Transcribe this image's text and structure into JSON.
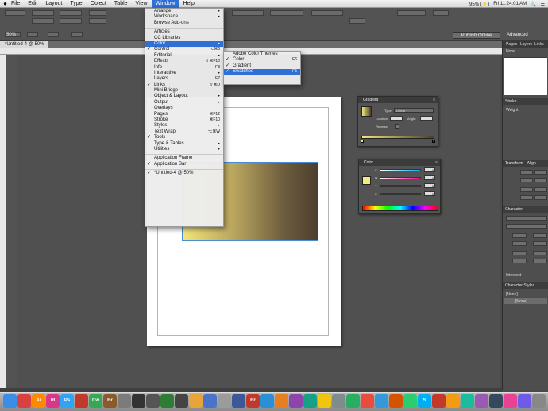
{
  "menubar": {
    "apple": "",
    "items": [
      "File",
      "Edit",
      "Layout",
      "Type",
      "Object",
      "Table",
      "View",
      "Window",
      "Help"
    ],
    "active": "Window",
    "status_right": [
      "95% (⚡)",
      "Fri 11:24:01 AM",
      "🔍",
      "☰"
    ]
  },
  "control_bar": {
    "zoom": "50%",
    "publish_button": "Publish Online",
    "workspace": "Advanced",
    "doc_tab": "*Untitled-4 @ 50%"
  },
  "window_menu": {
    "items": [
      {
        "label": "Arrange",
        "arrow": "▸"
      },
      {
        "label": "Workspace",
        "arrow": "▸"
      },
      {
        "label": "Browse Add-ons"
      },
      {
        "sep": true
      },
      {
        "label": "Articles"
      },
      {
        "label": "CC Libraries"
      },
      {
        "label": "Color",
        "arrow": "▸",
        "highlight": true
      },
      {
        "label": "Control",
        "check": "✓",
        "shortcut": "⌥⌘6"
      },
      {
        "label": "Editorial",
        "arrow": "▸"
      },
      {
        "label": "Effects",
        "shortcut": "⇧⌘F10"
      },
      {
        "label": "Info",
        "shortcut": "F8"
      },
      {
        "label": "Interactive",
        "arrow": "▸"
      },
      {
        "label": "Layers",
        "shortcut": "F7"
      },
      {
        "label": "Links",
        "check": "✓",
        "shortcut": "⇧⌘D"
      },
      {
        "label": "Mini Bridge"
      },
      {
        "label": "Object & Layout",
        "arrow": "▸"
      },
      {
        "label": "Output",
        "arrow": "▸"
      },
      {
        "label": "Overlays"
      },
      {
        "label": "Pages",
        "shortcut": "⌘F12"
      },
      {
        "label": "Stroke",
        "shortcut": "⌘F10"
      },
      {
        "label": "Styles",
        "arrow": "▸"
      },
      {
        "label": "Text Wrap",
        "shortcut": "⌥⌘W"
      },
      {
        "label": "Tools",
        "check": "✓"
      },
      {
        "label": "Type & Tables",
        "arrow": "▸"
      },
      {
        "label": "Utilities",
        "arrow": "▸"
      },
      {
        "sep": true
      },
      {
        "label": "Application Frame"
      },
      {
        "label": "Application Bar",
        "check": "✓"
      },
      {
        "sep": true
      },
      {
        "label": "*Untitled-4 @ 50%",
        "check": "✓"
      }
    ]
  },
  "color_submenu": {
    "items": [
      {
        "label": "Adobe Color Themes"
      },
      {
        "label": "Color",
        "check": "✓",
        "shortcut": "F6"
      },
      {
        "label": "Gradient",
        "check": "✓"
      },
      {
        "label": "Swatches",
        "check": "✓",
        "shortcut": "F5",
        "highlight": true
      }
    ]
  },
  "gradient_panel": {
    "title": "Gradient",
    "type_label": "Type:",
    "type_value": "Linear",
    "location_label": "Location:",
    "angle_label": "Angle:",
    "reverse_label": "Reverse:"
  },
  "color_panel": {
    "title": "Color",
    "channels": [
      "C",
      "M",
      "Y",
      "K"
    ],
    "values": [
      "0",
      "0",
      "0",
      "0"
    ],
    "swatch_color": "#f2ec7c"
  },
  "dock": {
    "tabs_top": [
      "Pages",
      "Layers",
      "Links"
    ],
    "pages_label": "None",
    "stroke_label": "Stroke",
    "weight_label": "Weight",
    "transform_tabs": [
      "Transform",
      "Align"
    ],
    "character_label": "Character",
    "char_styles_label": "Character Styles",
    "none_style": "[None]",
    "basic_style": "[None]",
    "para_label": "Intersect"
  },
  "canvas": {
    "gradient_start": "#f3e57a",
    "gradient_end": "#4c3f2e"
  },
  "os_dock": {
    "apps": [
      {
        "label": "",
        "color": "#3a8ee6"
      },
      {
        "label": "",
        "color": "#d94040"
      },
      {
        "label": "Ai",
        "color": "#ff8a00"
      },
      {
        "label": "Id",
        "color": "#d9388a"
      },
      {
        "label": "Ps",
        "color": "#2fa3f5"
      },
      {
        "label": "",
        "color": "#c0392b"
      },
      {
        "label": "Dw",
        "color": "#35a853"
      },
      {
        "label": "Br",
        "color": "#8a5a2a"
      },
      {
        "label": "",
        "color": "#7b7b7b"
      },
      {
        "label": "",
        "color": "#333333"
      },
      {
        "label": "",
        "color": "#555555"
      },
      {
        "label": "",
        "color": "#2f7d32"
      },
      {
        "label": "",
        "color": "#444444"
      },
      {
        "label": "",
        "color": "#e8a33b"
      },
      {
        "label": "",
        "color": "#4a74c9"
      },
      {
        "label": "",
        "color": "#9b9b9b"
      },
      {
        "label": "",
        "color": "#3b5998"
      },
      {
        "label": "Fz",
        "color": "#c0392b"
      },
      {
        "label": "",
        "color": "#2c8fd6"
      },
      {
        "label": "",
        "color": "#e67e22"
      },
      {
        "label": "",
        "color": "#8e44ad"
      },
      {
        "label": "",
        "color": "#16a085"
      },
      {
        "label": "",
        "color": "#f1c40f"
      },
      {
        "label": "",
        "color": "#7f8c8d"
      },
      {
        "label": "",
        "color": "#27ae60"
      },
      {
        "label": "",
        "color": "#e74c3c"
      },
      {
        "label": "",
        "color": "#3498db"
      },
      {
        "label": "",
        "color": "#d35400"
      },
      {
        "label": "",
        "color": "#2ecc71"
      },
      {
        "label": "S",
        "color": "#00aff0"
      },
      {
        "label": "",
        "color": "#c0392b"
      },
      {
        "label": "",
        "color": "#f39c12"
      },
      {
        "label": "",
        "color": "#1abc9c"
      },
      {
        "label": "",
        "color": "#9b59b6"
      },
      {
        "label": "",
        "color": "#34495e"
      },
      {
        "label": "",
        "color": "#e84393"
      },
      {
        "label": "",
        "color": "#6c5ce7"
      },
      {
        "label": "",
        "color": "#888888"
      }
    ]
  }
}
